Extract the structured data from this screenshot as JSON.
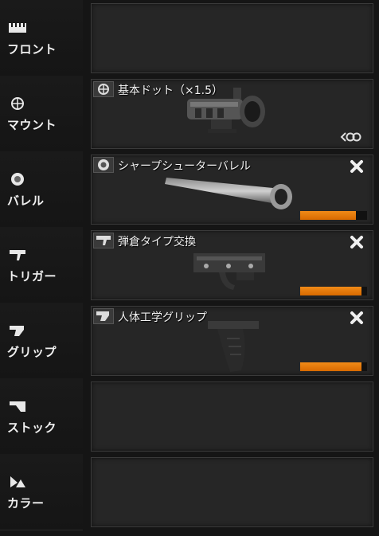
{
  "categories": [
    {
      "label": "フロント",
      "icon": "front-rail-icon"
    },
    {
      "label": "マウント",
      "icon": "crosshair-icon"
    },
    {
      "label": "バレル",
      "icon": "barrel-icon"
    },
    {
      "label": "トリガー",
      "icon": "trigger-icon"
    },
    {
      "label": "グリップ",
      "icon": "grip-icon"
    },
    {
      "label": "ストック",
      "icon": "stock-icon"
    },
    {
      "label": "カラー",
      "icon": "color-icon"
    }
  ],
  "slots": {
    "mount": {
      "name": "基本ドット（×1.5）",
      "icon": "crosshair-icon"
    },
    "barrel": {
      "name": "シャープシューターバレル",
      "icon": "barrel-icon",
      "durability_pct": 83
    },
    "trigger": {
      "name": "弾倉タイプ交換",
      "icon": "trigger-icon",
      "durability_pct": 92
    },
    "grip": {
      "name": "人体工学グリップ",
      "icon": "grip-icon",
      "durability_pct": 92
    }
  },
  "colors": {
    "durability": "#e57a10",
    "background": "#151515",
    "slot": "#262626"
  }
}
